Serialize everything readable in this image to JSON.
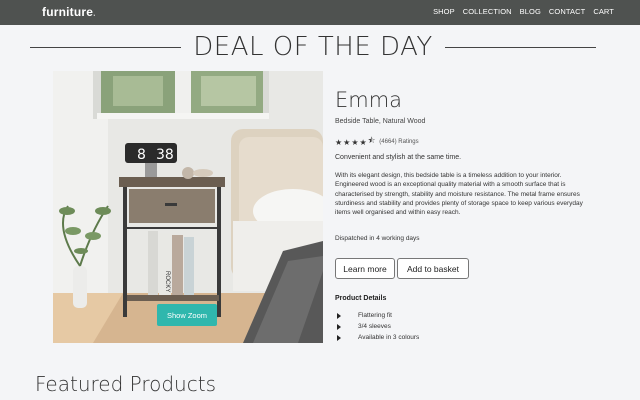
{
  "brand": {
    "name": "furniture",
    "dot": "."
  },
  "nav": [
    "SHOP",
    "COLLECTION",
    "BLOG",
    "CONTACT",
    "CART"
  ],
  "deal_title": "DEAL OF THE DAY",
  "product": {
    "title": "Emma",
    "subtitle": "Bedside Table, Natural Wood",
    "rating_stars": 4.5,
    "rating_text": "(4664) Ratings",
    "tagline": "Convenient and stylish at the same time.",
    "description": "With its elegant design, this bedside table is a timeless addition to your interior. Engineered wood is an exceptional quality material with a smooth surface that is characterised by strength, stability and moisture resistance. The metal frame ensures sturdiness and stability and provides plenty of storage space to keep various everyday items well organised and within easy reach.",
    "dispatch": "Dispatched in 4 working days",
    "zoom_label": "Show Zoom",
    "learn_more_label": "Learn more",
    "add_basket_label": "Add to basket",
    "details_heading": "Product Details",
    "details": [
      "Flattering fit",
      "3/4 sleeves",
      "Available in 3 colours"
    ],
    "clock_time_hours": "8",
    "clock_time_minutes": "38",
    "book_spine_text": "ROCKY"
  },
  "featured_heading": "Featured Products",
  "colors": {
    "navbar": "#4f5250",
    "accent": "#2fb7ad",
    "background": "#f4f5f7"
  }
}
